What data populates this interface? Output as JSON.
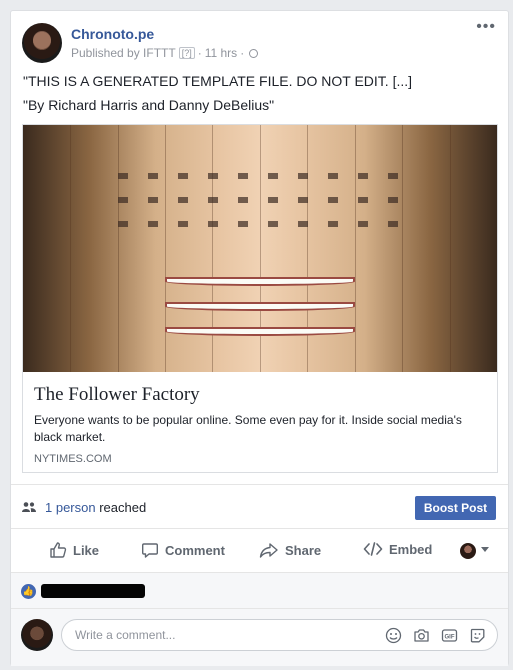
{
  "post": {
    "page_name": "Chronoto.pe",
    "published_by": "Published by IFTTT",
    "help_mark": "[?]",
    "separator": "·",
    "time": "11 hrs",
    "more": "•••",
    "text_line1": "\"THIS IS A GENERATED TEMPLATE FILE. DO NOT EDIT. [...]",
    "text_line2": "\"By Richard Harris and Danny DeBelius\""
  },
  "link": {
    "title": "The Follower Factory",
    "description": "Everyone wants to be popular online. Some even pay for it. Inside social media's black market.",
    "domain": "NYTIMES.COM"
  },
  "reach": {
    "link_text": "1 person",
    "suffix": " reached",
    "boost_label": "Boost Post"
  },
  "actions": {
    "like": "Like",
    "comment": "Comment",
    "share": "Share",
    "embed": "Embed"
  },
  "comment": {
    "placeholder": "Write a comment..."
  },
  "colors": {
    "link_blue": "#365899",
    "boost_blue": "#4267b2",
    "muted": "#606770"
  },
  "icons": [
    "more-icon",
    "globe-icon",
    "people-icon",
    "like-icon",
    "comment-icon",
    "share-icon",
    "embed-icon",
    "like-badge-icon",
    "emoji-icon",
    "camera-icon",
    "gif-icon",
    "sticker-icon"
  ]
}
